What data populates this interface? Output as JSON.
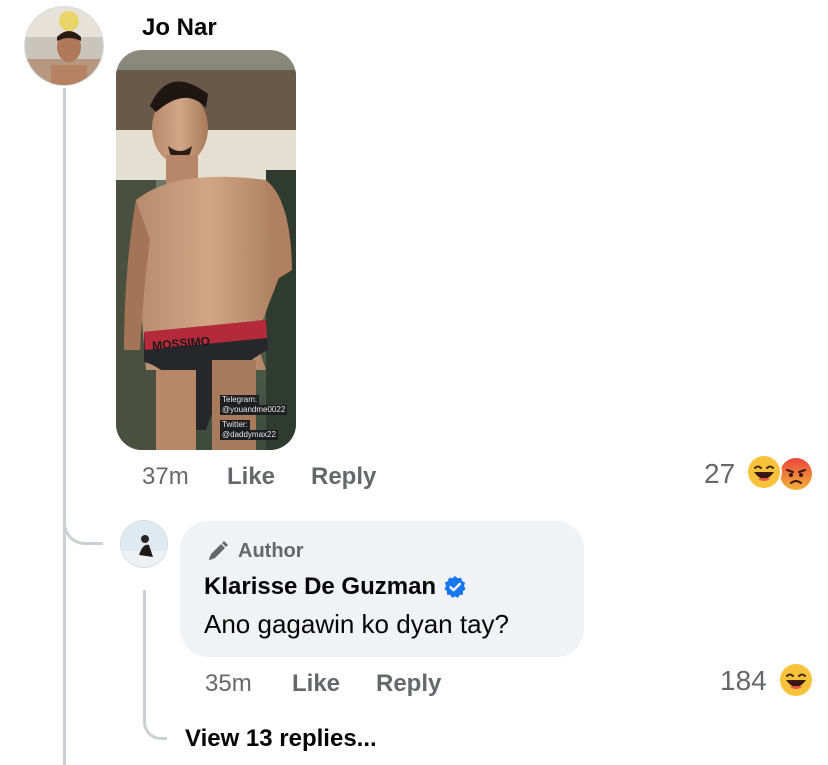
{
  "comment": {
    "author_name": "Jo Nar",
    "photo_watermark": {
      "line1": "Telegram:",
      "line2": "@youandme0022",
      "line3": "Twitter:",
      "line4": "@daddymax22",
      "brand": "MOSSIMO"
    },
    "time": "37m",
    "like_label": "Like",
    "reply_label": "Reply",
    "reaction_count": "27",
    "reactions": [
      "laughing-emoji",
      "angry-emoji"
    ]
  },
  "reply": {
    "badge_label": "Author",
    "author_name": "Klarisse De Guzman",
    "verified": true,
    "text": "Ano gagawin ko dyan tay?",
    "time": "35m",
    "like_label": "Like",
    "reply_label": "Reply",
    "reaction_count": "184",
    "reactions": [
      "laughing-emoji"
    ]
  },
  "view_replies_label": "View 13 replies...",
  "colors": {
    "secondary_text": "#65676b",
    "bubble_bg": "#f0f2f5",
    "verified_blue": "#1877f2",
    "thread_line": "#ccd0d5"
  }
}
